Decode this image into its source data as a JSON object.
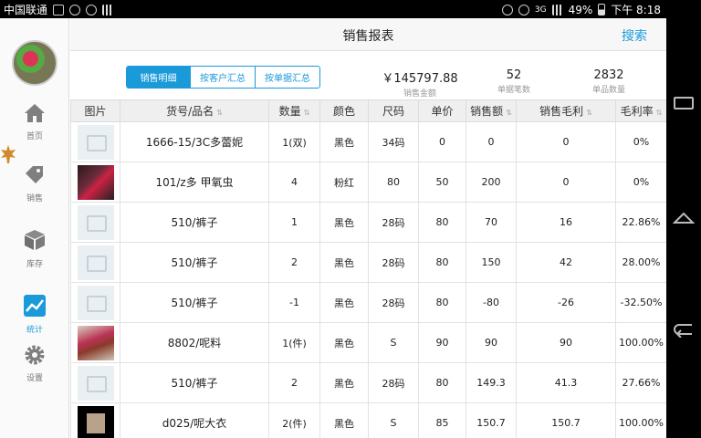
{
  "status_bar": {
    "carrier": "中国联通",
    "battery": "49%",
    "network": "3G",
    "time": "下午 8:18"
  },
  "sidebar": {
    "items": [
      {
        "label": "首页",
        "icon": "home-icon"
      },
      {
        "label": "销售",
        "icon": "tag-icon"
      },
      {
        "label": "库存",
        "icon": "box-icon"
      },
      {
        "label": "统计",
        "icon": "chart-icon",
        "active": true
      },
      {
        "label": "设置",
        "icon": "gear-icon"
      }
    ]
  },
  "header": {
    "title": "销售报表",
    "search_label": "搜索"
  },
  "tabs": [
    "销售明细",
    "按客户汇总",
    "按单据汇总"
  ],
  "summary": {
    "amount_value": "￥145797.88",
    "amount_label": "销售金额",
    "orders_value": "52",
    "orders_label": "单据笔数",
    "items_value": "2832",
    "items_label": "单品数量"
  },
  "table": {
    "headers": [
      "图片",
      "货号/品名",
      "数量",
      "颜色",
      "尺码",
      "单价",
      "销售额",
      "销售毛利",
      "毛利率"
    ],
    "rows": [
      {
        "pic": "ph",
        "name": "1666-15/3C多蕾妮",
        "qty": "1(双)",
        "color": "黑色",
        "size": "34码",
        "price": "0",
        "sales": "0",
        "profit": "0",
        "rate": "0%"
      },
      {
        "pic": "pic1",
        "name": "101/z多 甲氧虫",
        "qty": "4",
        "color": "粉红",
        "size": "80",
        "price": "50",
        "sales": "200",
        "profit": "0",
        "rate": "0%"
      },
      {
        "pic": "ph",
        "name": "510/裤子",
        "qty": "1",
        "color": "黑色",
        "size": "28码",
        "price": "80",
        "sales": "70",
        "profit": "16",
        "rate": "22.86%"
      },
      {
        "pic": "ph",
        "name": "510/裤子",
        "qty": "2",
        "color": "黑色",
        "size": "28码",
        "price": "80",
        "sales": "150",
        "profit": "42",
        "rate": "28.00%"
      },
      {
        "pic": "ph",
        "name": "510/裤子",
        "qty": "-1",
        "color": "黑色",
        "size": "28码",
        "price": "80",
        "sales": "-80",
        "profit": "-26",
        "rate": "-32.50%"
      },
      {
        "pic": "pic2",
        "name": "8802/呢料",
        "qty": "1(件)",
        "color": "黑色",
        "size": "S",
        "price": "90",
        "sales": "90",
        "profit": "90",
        "rate": "100.00%"
      },
      {
        "pic": "ph",
        "name": "510/裤子",
        "qty": "2",
        "color": "黑色",
        "size": "28码",
        "price": "80",
        "sales": "149.3",
        "profit": "41.3",
        "rate": "27.66%"
      },
      {
        "pic": "pic3",
        "name": "d025/呢大衣",
        "qty": "2(件)",
        "color": "黑色",
        "size": "S",
        "price": "85",
        "sales": "150.7",
        "profit": "150.7",
        "rate": "100.00%"
      }
    ]
  },
  "colors": {
    "accent": "#1a9ad8",
    "header_bg": "#efefef"
  }
}
